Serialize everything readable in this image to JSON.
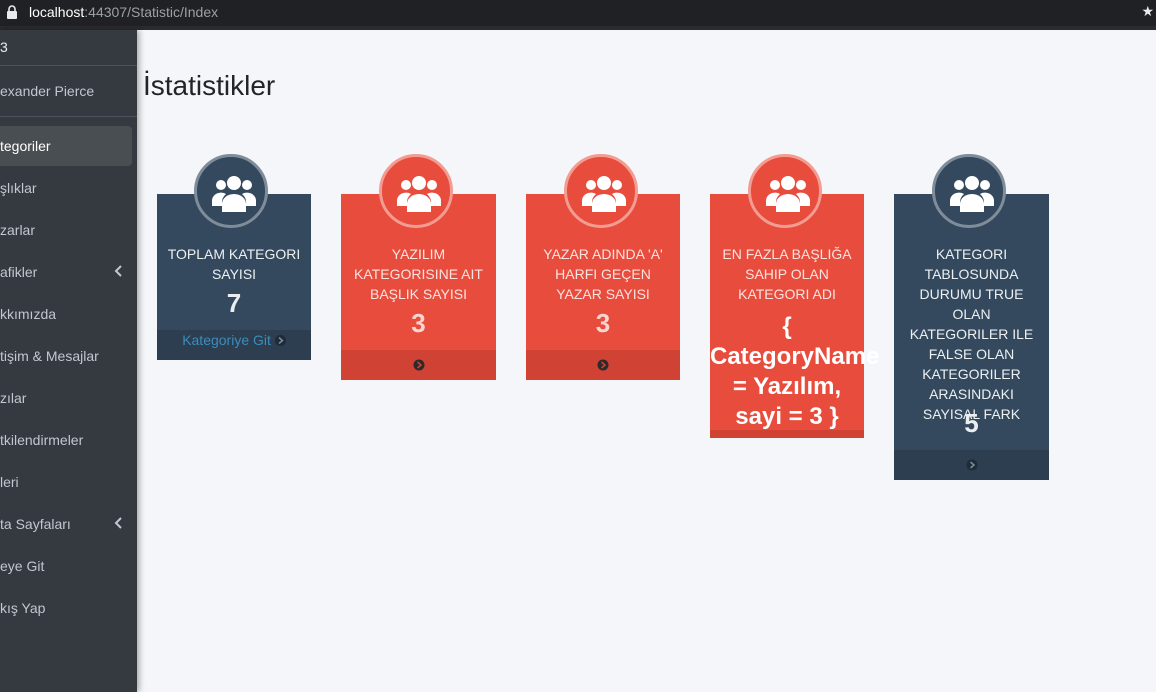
{
  "browser": {
    "url_host": "localhost",
    "url_rest": ":44307/Statistic/Index"
  },
  "sidebar": {
    "brand": "3",
    "user_name": "exander Pierce",
    "items": [
      {
        "label": "tegoriler",
        "active": true
      },
      {
        "label": "şlıklar"
      },
      {
        "label": "zarlar"
      },
      {
        "label": "afikler",
        "has_children": true
      },
      {
        "label": "kkımızda"
      },
      {
        "label": "tişim & Mesajlar"
      },
      {
        "label": "zılar"
      },
      {
        "label": "tkilendirmeler"
      },
      {
        "label": "leri"
      },
      {
        "label": "ta Sayfaları",
        "has_children": true
      },
      {
        "label": "eye Git"
      },
      {
        "label": "kış Yap"
      }
    ]
  },
  "main": {
    "title": "İstatistikler",
    "cards": [
      {
        "style": "dark",
        "title": "TOPLAM KATEGORI SAYISI",
        "value": "7",
        "footer_link": "Kategoriye Git"
      },
      {
        "style": "red",
        "title": "YAZILIM KATEGORISINE AIT BAŞLIK SAYISI",
        "value": "3"
      },
      {
        "style": "red",
        "title": "YAZAR ADINDA 'A' HARFI GEÇEN YAZAR SAYISI",
        "value": "3"
      },
      {
        "style": "red",
        "title": "EN FAZLA BAŞLIĞA SAHIP OLAN KATEGORI ADI",
        "value": "{ CategoryName = Yazılım, sayi = 3 }"
      },
      {
        "style": "dark",
        "title": "KATEGORI TABLOSUNDA DURUMU TRUE OLAN KATEGORILER ILE FALSE OLAN KATEGORILER ARASINDAKI SAYISAL FARK",
        "value": "5"
      }
    ]
  },
  "colors": {
    "card_dark": "#34495e",
    "card_red": "#e74c3c",
    "sidebar_bg": "#343a40",
    "link": "#3c8dbc"
  },
  "icons": {
    "card_icon": "users-icon",
    "footer_icon": "circle-arrow-right-icon",
    "lock": "lock-icon"
  }
}
